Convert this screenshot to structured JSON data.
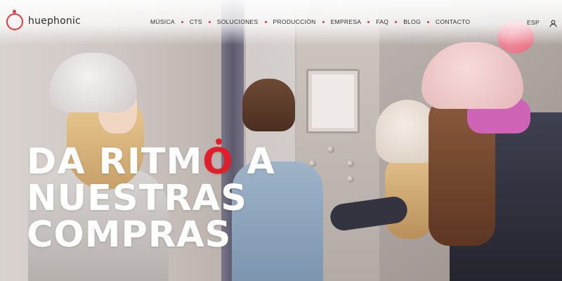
{
  "brand": {
    "name": "huephonic",
    "accent_color": "#e01f2a"
  },
  "nav": {
    "items": [
      {
        "label": "MÚSICA"
      },
      {
        "label": "CTS"
      },
      {
        "label": "SOLUCIONES"
      },
      {
        "label": "PRODUCCIÓN"
      },
      {
        "label": "EMPRESA"
      },
      {
        "label": "FAQ"
      },
      {
        "label": "BLOG"
      },
      {
        "label": "CONTACTO"
      }
    ],
    "language": "ESP",
    "user_icon": "user-icon"
  },
  "hero": {
    "line1_before": "DA RITM",
    "line1_accent": "O",
    "line1_after": " A",
    "line2": "NUESTRAS",
    "line3": "COMPRAS"
  }
}
